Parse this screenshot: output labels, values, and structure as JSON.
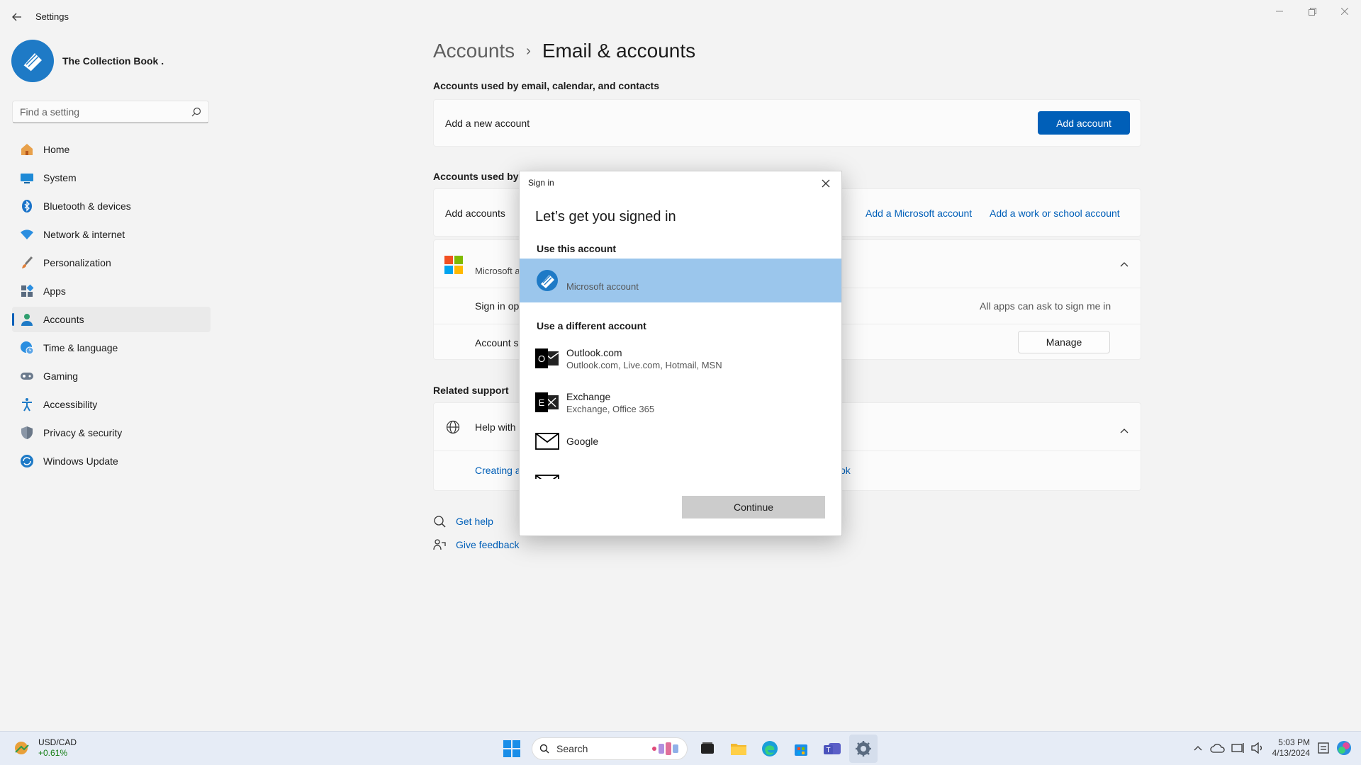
{
  "window": {
    "title": "Settings"
  },
  "sidebar": {
    "profile_name": "The Collection Book .",
    "search_placeholder": "Find a setting",
    "items": [
      {
        "label": "Home",
        "icon": "home-icon"
      },
      {
        "label": "System",
        "icon": "monitor-icon"
      },
      {
        "label": "Bluetooth & devices",
        "icon": "bluetooth-icon"
      },
      {
        "label": "Network & internet",
        "icon": "wifi-icon"
      },
      {
        "label": "Personalization",
        "icon": "brush-icon"
      },
      {
        "label": "Apps",
        "icon": "apps-icon"
      },
      {
        "label": "Accounts",
        "icon": "person-icon"
      },
      {
        "label": "Time & language",
        "icon": "globe-clock-icon"
      },
      {
        "label": "Gaming",
        "icon": "gamepad-icon"
      },
      {
        "label": "Accessibility",
        "icon": "accessibility-icon"
      },
      {
        "label": "Privacy & security",
        "icon": "shield-icon"
      },
      {
        "label": "Windows Update",
        "icon": "update-icon"
      }
    ]
  },
  "main": {
    "breadcrumb": {
      "parent": "Accounts",
      "separator": "›",
      "current": "Email & accounts"
    },
    "email_section": {
      "title": "Accounts used by email, calendar, and contacts",
      "row_label": "Add a new account",
      "button": "Add account"
    },
    "other_section": {
      "title": "Accounts used by c",
      "add_accounts_label": "Add accounts",
      "link_ms": "Add a Microsoft account",
      "link_work": "Add a work or school account",
      "ms_account_label": "Microsoft a",
      "sign_in_label": "Sign in op",
      "sign_in_value": "All apps can ask to sign me in",
      "account_settings_label": "Account se",
      "manage_button": "Manage"
    },
    "related_support": {
      "title": "Related support",
      "help_label": "Help with",
      "creating_link": "Creating a",
      "creating_link_tail": "ok"
    },
    "footer": {
      "get_help": "Get help",
      "give_feedback": "Give feedback"
    }
  },
  "dialog": {
    "title": "Sign in",
    "heading": "Let’s get you signed in",
    "use_this": "Use this account",
    "current_account": "Microsoft account",
    "use_different": "Use a different account",
    "options": [
      {
        "name": "Outlook.com",
        "sub": "Outlook.com, Live.com, Hotmail, MSN"
      },
      {
        "name": "Exchange",
        "sub": "Exchange, Office 365"
      },
      {
        "name": "Google",
        "sub": ""
      }
    ],
    "continue": "Continue"
  },
  "taskbar": {
    "ticker_name": "USD/CAD",
    "ticker_change": "+0.61%",
    "search": "Search",
    "time": "5:03 PM",
    "date": "4/13/2024"
  },
  "colors": {
    "accent": "#005fb8",
    "selected_row": "#9bc6ec",
    "taskbar": "#e6ecf6"
  }
}
